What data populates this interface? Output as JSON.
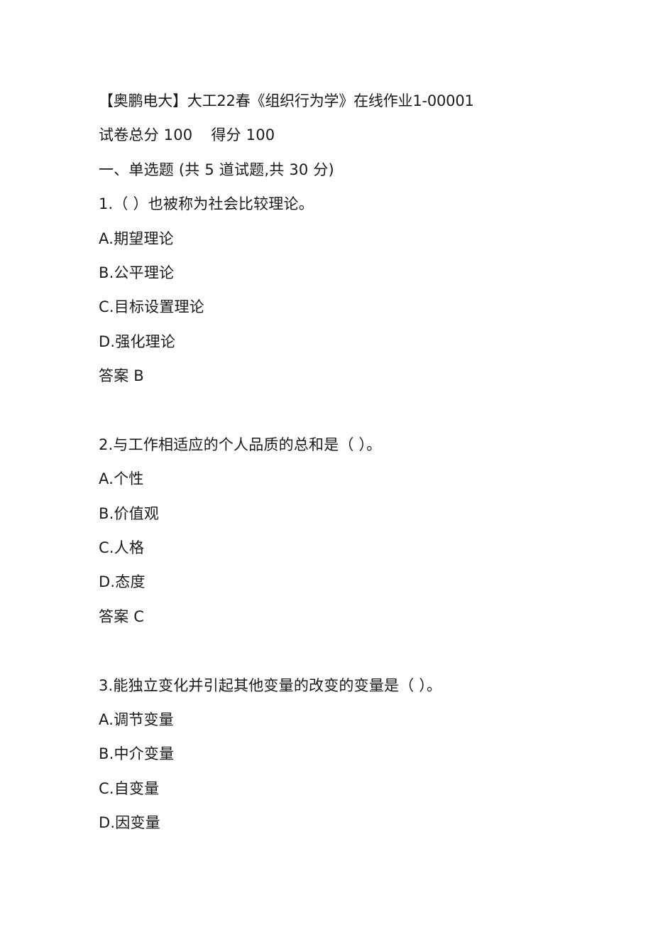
{
  "document": {
    "title": "【奥鹏电大】大工22春《组织行为学》在线作业1-00001",
    "total_score_label": "试卷总分 100",
    "obtained_score_label": "得分 100",
    "section_heading": "一、单选题  (共  5  道试题,共  30  分)",
    "questions": [
      {
        "stem": "1.（  ）也被称为社会比较理论。",
        "options": [
          "A.期望理论",
          "B.公平理论",
          "C.目标设置理论",
          "D.强化理论"
        ],
        "answer": "答案 B"
      },
      {
        "stem": "2.与工作相适应的个人品质的总和是（  ）。",
        "options": [
          "A.个性",
          "B.价值观",
          "C.人格",
          "D.态度"
        ],
        "answer": "答案 C"
      },
      {
        "stem": "3.能独立变化并引起其他变量的改变的变量是（  ）。",
        "options": [
          "A.调节变量",
          "B.中介变量",
          "C.自变量",
          "D.因变量"
        ]
      }
    ]
  }
}
